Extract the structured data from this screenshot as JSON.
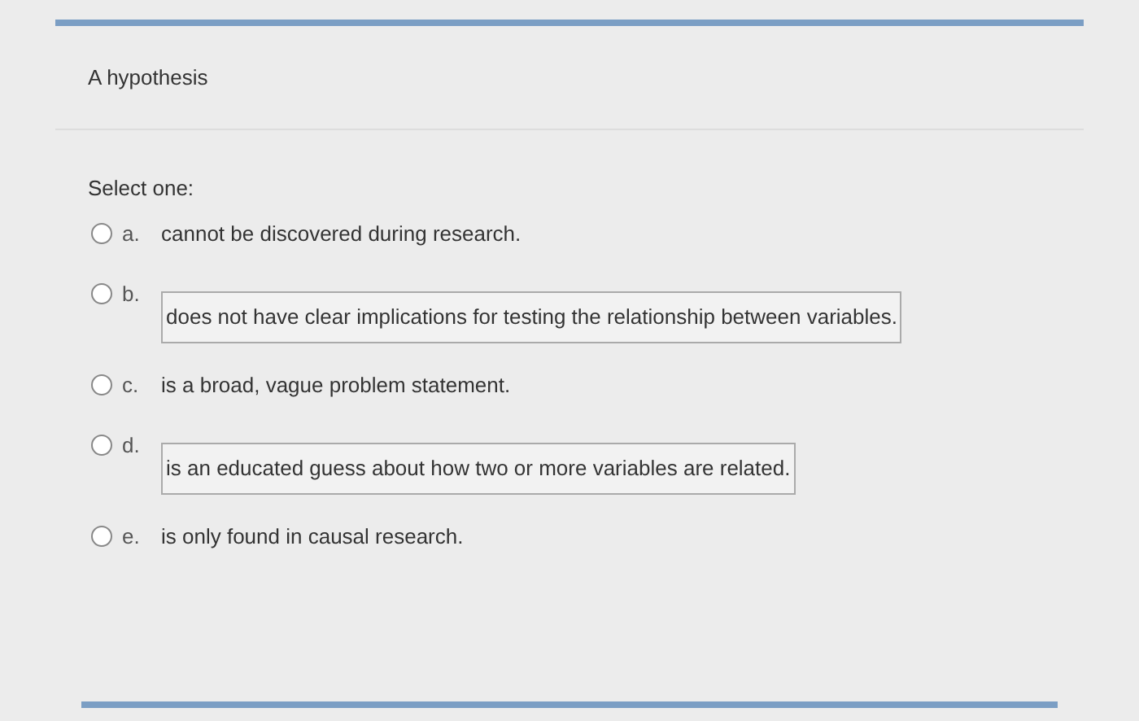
{
  "question": {
    "text": "A hypothesis"
  },
  "prompt": "Select one:",
  "options": [
    {
      "letter": "a.",
      "text": "cannot be discovered during research.",
      "kind": "plain",
      "selected": false
    },
    {
      "letter": "b.",
      "text": "does not have clear implications for testing the relationship between variables.",
      "kind": "boxed",
      "selected": false
    },
    {
      "letter": "c.",
      "text": "is a broad, vague problem statement.",
      "kind": "plain",
      "selected": false
    },
    {
      "letter": "d.",
      "text": "is an educated guess about how two or more variables are related.",
      "kind": "boxed",
      "selected": false
    },
    {
      "letter": "e.",
      "text": "is only found in causal research.",
      "kind": "plain",
      "selected": false
    }
  ]
}
